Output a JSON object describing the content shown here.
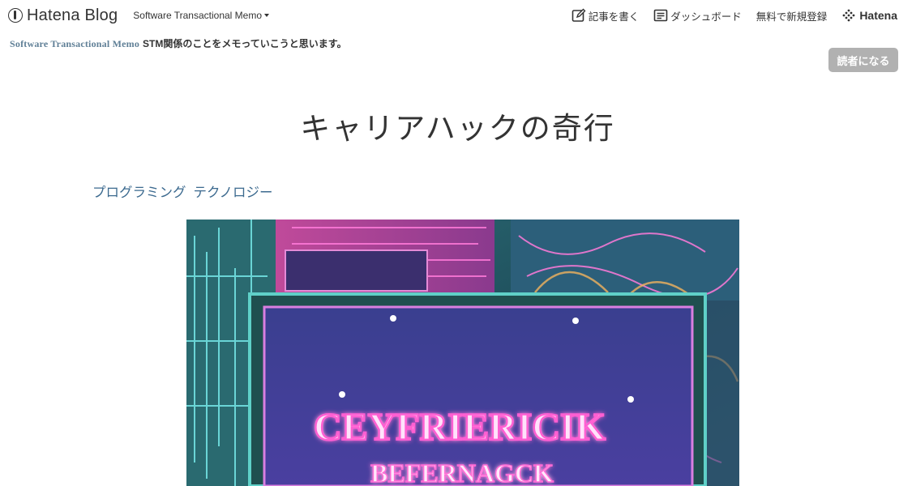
{
  "topbar": {
    "logo_text": "Hatena Blog",
    "blog_switch_label": "Software Transactional Memo",
    "nav": {
      "write_label": "記事を書く",
      "dashboard_label": "ダッシュボード",
      "signup_label": "無料で新規登録",
      "hatena_label": "Hatena"
    }
  },
  "blog": {
    "title": "Software Transactional Memo",
    "description": "STM関係のことをメモっていこうと思います。",
    "subscribe_label": "読者になる"
  },
  "entry": {
    "title": "キャリアハックの奇行",
    "categories": [
      "プログラミング",
      "テクノロジー"
    ],
    "image": {
      "sign_line1": "CEYFRIERICIK",
      "sign_line2": "BEFERNAGCK"
    }
  },
  "colors": {
    "blog_title": "#5f7f96",
    "category_link": "#3c6a8f",
    "subscribe_bg": "#b1b1b1"
  },
  "icons": {
    "logo": "hatena-blog-logo-icon",
    "write": "pencil-square-icon",
    "dashboard": "dashboard-list-icon",
    "hatena": "hatena-dots-icon"
  }
}
